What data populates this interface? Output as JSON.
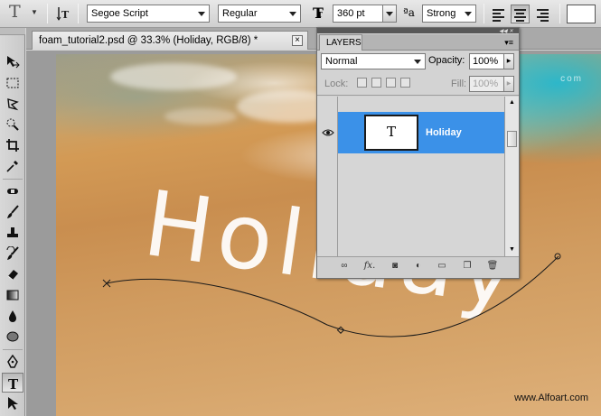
{
  "options_bar": {
    "tool_glyph": "T",
    "font_family": "Segoe Script",
    "font_style": "Regular",
    "font_size": "360 pt",
    "anti_alias": "Strong",
    "anti_alias_glyph": "ªa",
    "text_color": "#ffffff"
  },
  "document": {
    "tab_title": "foam_tutorial2.psd @ 33.3% (Holiday, RGB/8) *",
    "close": "×"
  },
  "canvas": {
    "text": "Holiday",
    "watermark": "www.Alfoart.com",
    "watermark_top": "com"
  },
  "layers_panel": {
    "tab_label": "LAYERS",
    "blend_mode": "Normal",
    "opacity_label": "Opacity:",
    "opacity_value": "100%",
    "lock_label": "Lock:",
    "fill_label": "Fill:",
    "fill_value": "100%",
    "layer": {
      "name": "Holiday",
      "thumb_glyph": "T",
      "selected_color": "#3b91e8"
    }
  },
  "tools": [
    "move-tool",
    "marquee-tool",
    "lasso-tool",
    "quick-selection-tool",
    "crop-tool",
    "eyedropper-tool",
    "healing-brush-tool",
    "brush-tool",
    "clone-stamp-tool",
    "history-brush-tool",
    "eraser-tool",
    "gradient-tool",
    "blur-tool",
    "dodge-tool",
    "pen-tool",
    "type-tool",
    "path-selection-tool"
  ],
  "active_tool": "type-tool"
}
